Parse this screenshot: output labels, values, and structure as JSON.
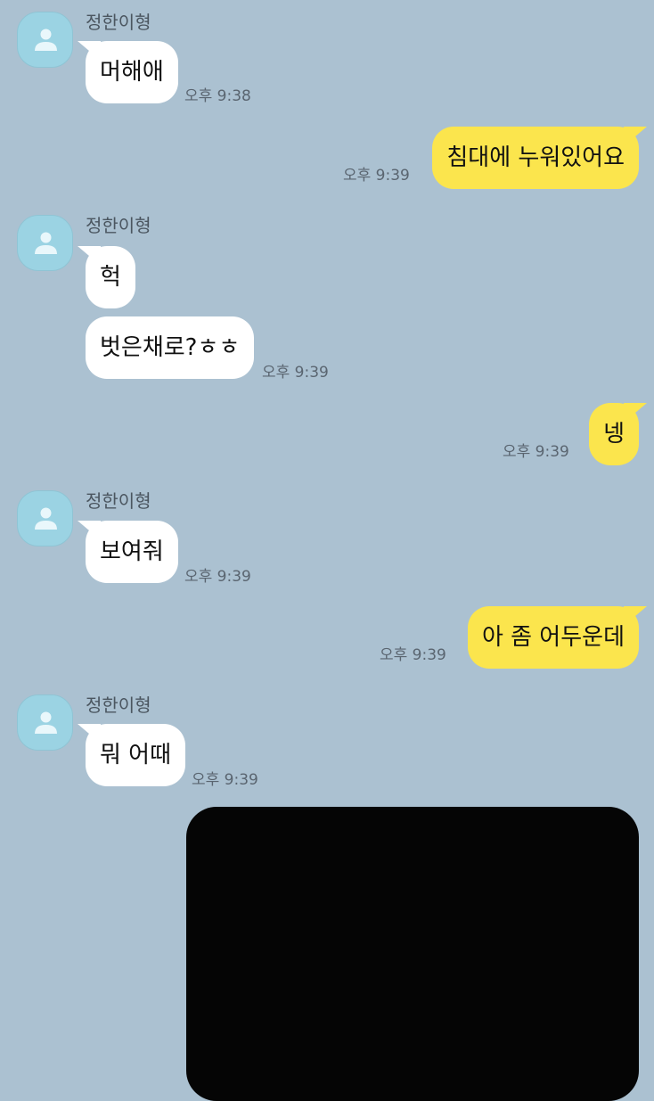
{
  "chat": {
    "contact_name": "정한이형",
    "messages": [
      {
        "id": "m1",
        "side": "received",
        "text": "머해애"
      },
      {
        "id": "m2",
        "side": "sent",
        "text": "침대에 누워있어요"
      },
      {
        "id": "m3",
        "side": "received",
        "text": "헉"
      },
      {
        "id": "m4",
        "side": "received",
        "text": "벗은채로?ㅎㅎ"
      },
      {
        "id": "m5",
        "side": "sent",
        "text": "넹"
      },
      {
        "id": "m6",
        "side": "received",
        "text": "보여줘"
      },
      {
        "id": "m7",
        "side": "sent",
        "text": "아 좀 어두운데"
      },
      {
        "id": "m8",
        "side": "received",
        "text": "뭐 어때"
      }
    ],
    "times": {
      "t1": "오후 9:38",
      "t2": "오후 9:39",
      "t3": "오후 9:39",
      "t4": "오후 9:39",
      "t5": "오후 9:39",
      "t6": "오후 9:39",
      "t7": "오후 9:39"
    }
  },
  "colors": {
    "background": "#abc1d1",
    "received_bubble": "#ffffff",
    "sent_bubble": "#fbe54d",
    "avatar": "#9bd3e3",
    "photo": "#050505"
  },
  "icons": {
    "avatar": "default-profile-person-icon"
  }
}
